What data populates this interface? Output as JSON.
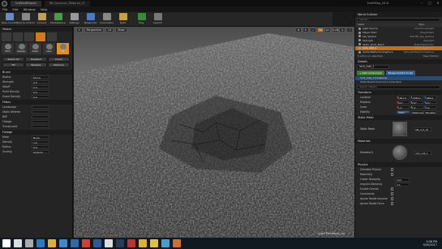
{
  "window": {
    "tabs": [
      "UntitledProject",
      "BB_Dynamic_Material_v1"
    ],
    "project_name": "DraftMap_U4.8"
  },
  "menu": [
    "File",
    "Edit",
    "Window",
    "Help"
  ],
  "toolbar": [
    {
      "label": "Save Current",
      "icon": "save-icon",
      "color": "#6a8ac0"
    },
    {
      "label": "Source Control",
      "icon": "source-control-icon",
      "color": "#888888"
    },
    {
      "label": "Content",
      "icon": "content-icon",
      "color": "#c0a060"
    },
    {
      "label": "Marketplace",
      "icon": "marketplace-icon",
      "color": "#4a9a4a"
    },
    {
      "label": "Settings",
      "icon": "settings-icon",
      "color": "#999999"
    },
    {
      "label": "Blueprints",
      "icon": "blueprints-icon",
      "color": "#4a7ac0"
    },
    {
      "label": "Cinematics",
      "icon": "cinematics-icon",
      "color": "#888888"
    },
    {
      "label": "Build",
      "icon": "build-icon",
      "color": "#c8a040"
    },
    {
      "label": "Play",
      "icon": "play-icon",
      "color": "#3a8a3a"
    },
    {
      "label": "Launch",
      "icon": "launch-icon",
      "color": "#777777"
    }
  ],
  "modes": {
    "title": "Modes",
    "tools": [
      "Paint",
      "Reapply",
      "Select",
      "Lasso",
      "Fill"
    ],
    "buttons": [
      "Select All",
      "Deselect",
      "Invert",
      "Fill",
      "Reapply",
      "Remove"
    ],
    "brush_header": "Brush",
    "brush_rows": [
      {
        "label": "Radius",
        "value": "512.0"
      },
      {
        "label": "Strength",
        "value": "0.5"
      },
      {
        "label": "Falloff",
        "value": "0.0"
      },
      {
        "label": "Paint Density",
        "value": "0.5"
      },
      {
        "label": "Erase Density",
        "value": "0.0"
      }
    ],
    "filter_header": "Filters",
    "filter_rows": [
      {
        "label": "Landscape",
        "value": ""
      },
      {
        "label": "Static Meshes",
        "value": ""
      },
      {
        "label": "BSP",
        "value": ""
      },
      {
        "label": "Foliage",
        "value": ""
      },
      {
        "label": "Translucent",
        "value": ""
      }
    ],
    "foliage_header": "Foliage",
    "foliage_rows": [
      {
        "label": "Mesh",
        "value": "None"
      },
      {
        "label": "Density",
        "value": "1.0"
      },
      {
        "label": "Radius",
        "value": "0.0"
      },
      {
        "label": "Scaling",
        "value": "Uniform"
      }
    ]
  },
  "viewport": {
    "buttons": [
      "Perspective",
      "Lit",
      "Show"
    ],
    "right_buttons": [
      "10",
      "10°",
      "0.25",
      "4"
    ],
    "level_label": "Level: Procedural_Lvl"
  },
  "outliner": {
    "tab": "World Outliner",
    "search_placeholder": "Search...",
    "col_label": "Label",
    "col_type": "Type",
    "rows": [
      {
        "label": "Light Source",
        "type": "DirectionalLight",
        "state": ""
      },
      {
        "label": "Player Start",
        "type": "PlayerStart",
        "state": ""
      },
      {
        "label": "Sky Sphere",
        "type": "Edit BP_Sky_Sphere",
        "state": ""
      },
      {
        "label": "SkyLight",
        "type": "SkyLight",
        "state": ""
      },
      {
        "label": "Static_Rock_Mesh",
        "type": "StaticMeshActor",
        "state": ""
      },
      {
        "label": "rock_mat_1",
        "type": "StaticMeshActor",
        "state": "selected"
      },
      {
        "label": "SphereReflectionCapture",
        "type": "SphereReflectionCapture",
        "state": ""
      }
    ],
    "status": "6 actors (1 selected)",
    "view_options": "View Options"
  },
  "details": {
    "tab": "Details",
    "name": "rock_mat_1",
    "add_component": "+ Add Component",
    "blueprint": "Blueprint/Add Script",
    "components": [
      "rock_mat_1 (Instance)",
      "StaticMeshComponent (Inherited)"
    ],
    "search_placeholder": "Search Details",
    "transform_header": "Transform",
    "transform": [
      {
        "label": "Location",
        "x": "1951.0",
        "y": "-2563.2",
        "z": "-860.0"
      },
      {
        "label": "Rotation",
        "x": "0.0°",
        "y": "0.0°",
        "z": "0.0°"
      },
      {
        "label": "Scale",
        "x": "1.0",
        "y": "1.0",
        "z": "1.0"
      }
    ],
    "mobility_label": "Mobility",
    "mobility_options": [
      "Static",
      "Stationary",
      "Movable"
    ],
    "static_mesh_header": "Static Mesh",
    "static_mesh_label": "Static Mesh",
    "static_mesh_value": "SM_rock_01",
    "materials_header": "Materials",
    "element_label": "Element 0",
    "element_value": "rock_mat_1",
    "physics_header": "Physics",
    "physics_rows": [
      {
        "label": "Simulate Physics"
      },
      {
        "label": "MassInKg"
      },
      {
        "label": "Linear Damping",
        "value": "0.01"
      },
      {
        "label": "Angular Damping",
        "value": "0.0"
      },
      {
        "label": "Enable Gravity"
      },
      {
        "label": "Constraints"
      },
      {
        "label": "Ignore Radial Impulse"
      },
      {
        "label": "Ignore Radial Force"
      }
    ]
  },
  "taskbar": {
    "icons": [
      "windows-start-icon",
      "search-icon",
      "task-view-icon",
      "edge-icon",
      "explorer-icon",
      "store-icon",
      "mail-icon",
      "chrome-icon",
      "photoshop-icon",
      "unreal-icon",
      "steam-icon",
      "media-icon",
      "folder-icon",
      "notes-icon",
      "calc-icon",
      "paint-icon"
    ],
    "time": "3:06 PM",
    "date": "9/30/2017"
  }
}
